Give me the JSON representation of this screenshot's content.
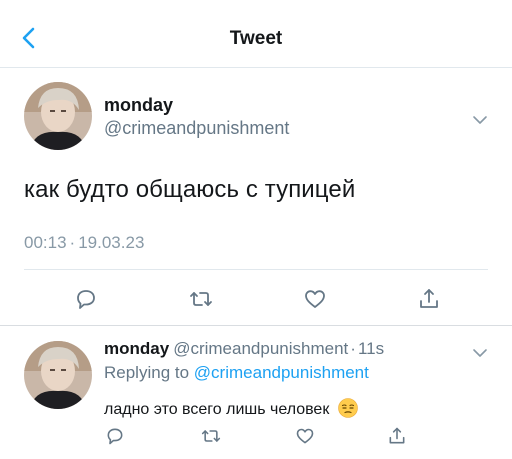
{
  "nav": {
    "title": "Tweet",
    "back_icon": "chevron-left-icon",
    "accent": "#1da1f2"
  },
  "tweet": {
    "author_name": "monday",
    "author_handle": "@crimeandpunishment",
    "text": "как будто общаюсь с тупицей",
    "time": "00:13",
    "separator": "·",
    "date": "19.03.23",
    "actions": [
      "reply-icon",
      "retweet-icon",
      "like-icon",
      "share-icon"
    ]
  },
  "reply": {
    "author_name": "monday",
    "author_handle": "@crimeandpunishment",
    "separator": "·",
    "time_ago": "11s",
    "replying_prefix": "Replying to",
    "replying_to": "@crimeandpunishment",
    "text": "ладно это всего лишь человек",
    "emoji": "unamused-face-emoji",
    "actions": [
      "reply-icon",
      "retweet-icon",
      "like-icon",
      "share-icon"
    ]
  }
}
